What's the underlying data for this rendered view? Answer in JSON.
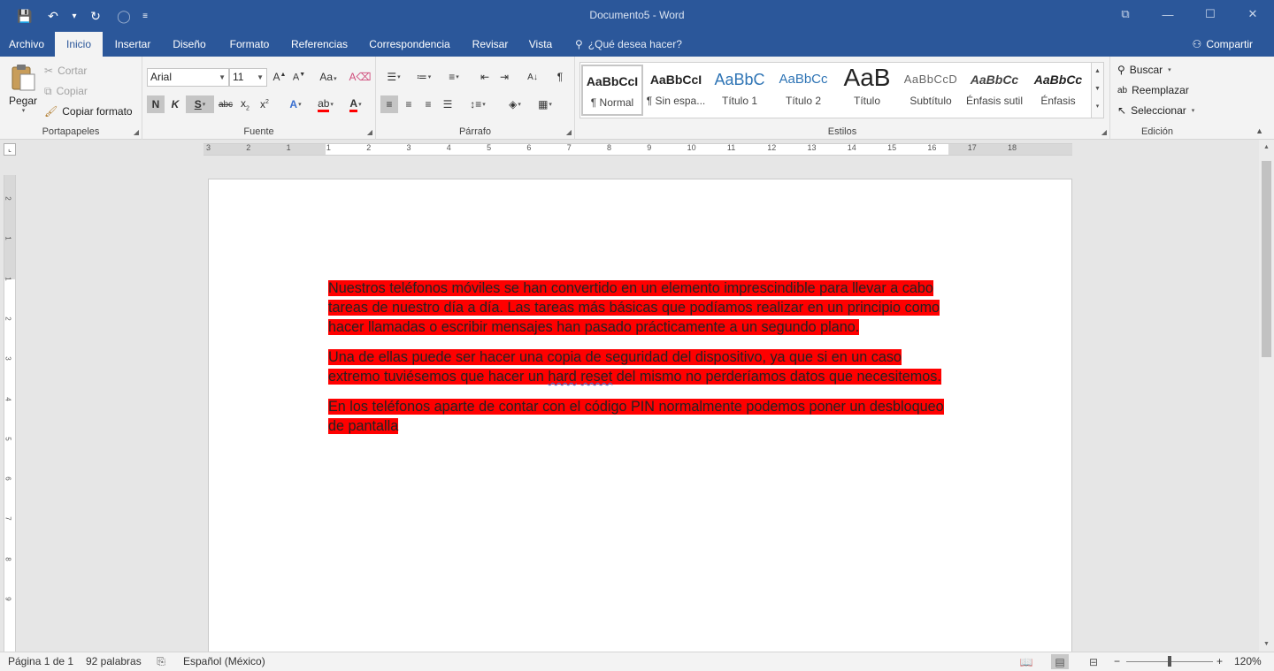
{
  "title_bar": {
    "doc_title": "Documento5 - Word",
    "qat": [
      {
        "name": "save-icon",
        "glyph": "💾"
      },
      {
        "name": "undo-icon",
        "glyph": "↶"
      },
      {
        "name": "undo-dropdown-icon",
        "glyph": "▾"
      },
      {
        "name": "redo-icon",
        "glyph": "↻"
      },
      {
        "name": "touch-mode-icon",
        "glyph": "◯"
      },
      {
        "name": "customize-qat-icon",
        "glyph": "≡"
      }
    ],
    "window_buttons": [
      {
        "name": "ribbon-display-icon",
        "glyph": "⧉"
      },
      {
        "name": "minimize-icon",
        "glyph": "—"
      },
      {
        "name": "maximize-icon",
        "glyph": "☐"
      },
      {
        "name": "close-icon",
        "glyph": "✕"
      }
    ]
  },
  "tabs": [
    "Archivo",
    "Inicio",
    "Insertar",
    "Diseño",
    "Formato",
    "Referencias",
    "Correspondencia",
    "Revisar",
    "Vista"
  ],
  "active_tab": "Inicio",
  "tell_me": "¿Qué desea hacer?",
  "share": "Compartir",
  "clipboard": {
    "label": "Portapapeles",
    "paste": "Pegar",
    "cut": "Cortar",
    "copy": "Copiar",
    "format_painter": "Copiar formato"
  },
  "font": {
    "label": "Fuente",
    "family": "Arial",
    "size": "11"
  },
  "paragraph": {
    "label": "Párrafo"
  },
  "styles": {
    "label": "Estilos",
    "items": [
      {
        "preview": "AaBbCcI",
        "name": "¶ Normal"
      },
      {
        "preview": "AaBbCcI",
        "name": "¶ Sin espa..."
      },
      {
        "preview": "AaBbC",
        "name": "Título 1"
      },
      {
        "preview": "AaBbCc",
        "name": "Título 2"
      },
      {
        "preview": "AaB",
        "name": "Título"
      },
      {
        "preview": "AaBbCcD",
        "name": "Subtítulo"
      },
      {
        "preview": "AaBbCc",
        "name": "Énfasis sutil"
      },
      {
        "preview": "AaBbCc",
        "name": "Énfasis"
      }
    ]
  },
  "editing": {
    "label": "Edición",
    "find": "Buscar",
    "replace": "Reemplazar",
    "select": "Seleccionar"
  },
  "ruler": {
    "numbers": [
      "3",
      "2",
      "1",
      "1",
      "2",
      "3",
      "4",
      "5",
      "6",
      "7",
      "8",
      "9",
      "10",
      "11",
      "12",
      "13",
      "14",
      "15",
      "16",
      "17",
      "18"
    ]
  },
  "vruler": {
    "numbers": [
      "2",
      "1",
      "1",
      "2",
      "3",
      "4",
      "5",
      "6",
      "7",
      "8",
      "9"
    ]
  },
  "document": {
    "p1": "Nuestros teléfonos móviles se han convertido en un elemento imprescindible para llevar a cabo tareas de nuestro día a día. Las tareas más básicas que podíamos realizar en un principio como hacer llamadas o escribir mensajes han pasado prácticamente a un segundo plano.",
    "p2_a": "Una de ellas puede ser hacer una copia de seguridad del dispositivo, ya que si en un caso extremo tuviésemos que hacer un ",
    "p2_hard": "hard",
    "p2_space": " ",
    "p2_reset": "reset",
    "p2_b": " del mismo no perderíamos datos que necesitemos.",
    "p3": "En los teléfonos aparte de contar con el código PIN normalmente podemos poner un desbloqueo de pantalla",
    "highlight_color": "#ff0000"
  },
  "status": {
    "page": "Página 1 de 1",
    "words": "92 palabras",
    "language": "Español (México)",
    "zoom": "120%"
  },
  "colors": {
    "accent": "#2b579a",
    "highlight": "#ff0000"
  }
}
